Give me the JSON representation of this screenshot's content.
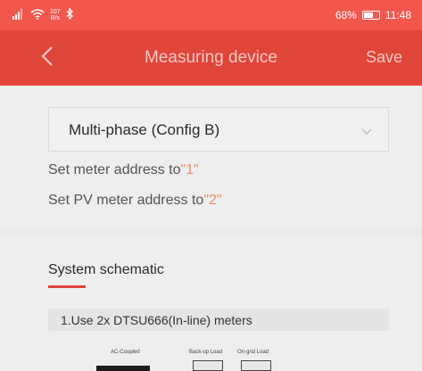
{
  "status": {
    "network_speed_value": "107",
    "network_speed_unit": "B/s",
    "battery": "68%",
    "battery_level": 0.68,
    "time": "11:48"
  },
  "header": {
    "title": "Measuring device",
    "save_label": "Save"
  },
  "config": {
    "selected": "Multi-phase (Config B)",
    "meter_prefix": "Set meter address to",
    "meter_value": "\"1\"",
    "pv_prefix": "Set PV meter address to",
    "pv_value": "\"2\""
  },
  "schematic": {
    "title": "System schematic",
    "note": "1.Use 2x DTSU666(In-line) meters",
    "labels": {
      "ac_coupled": "AC-Coupled",
      "backup_load": "Back-up Load",
      "ongrid_load": "On-grid Load"
    }
  },
  "colors": {
    "accent": "#e0453a",
    "highlight": "#e89067"
  }
}
